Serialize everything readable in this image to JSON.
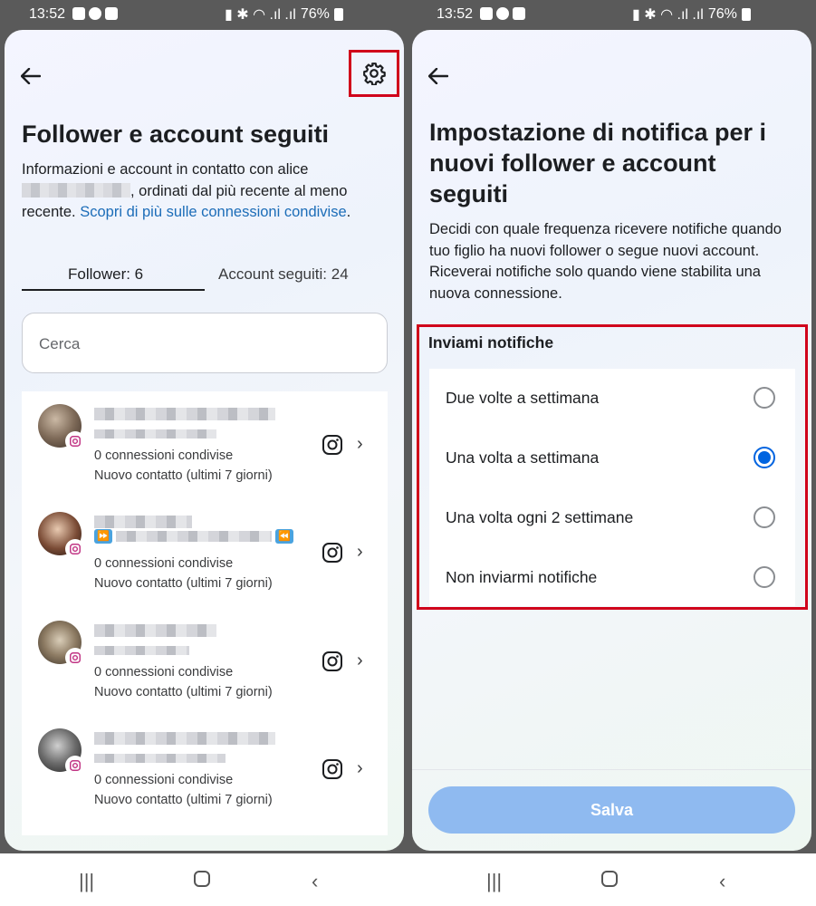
{
  "left": {
    "status": {
      "time": "13:52",
      "battery": "76%"
    },
    "title": "Follower e account seguiti",
    "desc_pre": "Informazioni e account in contatto con",
    "desc_name": "alice",
    "desc_post": ", ordinati dal più recente al meno recente.",
    "desc_link": "Scopri di più sulle connessioni condivise",
    "desc_end": ".",
    "tabs": {
      "followers": "Follower: 6",
      "following": "Account seguiti: 24"
    },
    "search_placeholder": "Cerca",
    "rows": [
      {
        "line1": "0 connessioni condivise",
        "line2": "Nuovo contatto (ultimi 7 giorni)"
      },
      {
        "line1": "0 connessioni condivise",
        "line2": "Nuovo contatto (ultimi 7 giorni)"
      },
      {
        "line1": "0 connessioni condivise",
        "line2": "Nuovo contatto (ultimi 7 giorni)"
      },
      {
        "line1": "0 connessioni condivise",
        "line2": "Nuovo contatto (ultimi 7 giorni)"
      }
    ]
  },
  "right": {
    "status": {
      "time": "13:52",
      "battery": "76%"
    },
    "title": "Impostazione di notifica per i nuovi follower e account seguiti",
    "desc": "Decidi con quale frequenza ricevere notifiche quando tuo figlio ha nuovi follower o segue nuovi account. Riceverai notifiche solo quando viene stabilita una nuova connessione.",
    "section": "Inviami notifiche",
    "options": [
      {
        "label": "Due volte a settimana",
        "selected": false
      },
      {
        "label": "Una volta a settimana",
        "selected": true
      },
      {
        "label": "Una volta ogni 2 settimane",
        "selected": false
      },
      {
        "label": "Non inviarmi notifiche",
        "selected": false
      }
    ],
    "save": "Salva"
  },
  "icons": {
    "back": "arrow-left-icon",
    "settings": "gear-icon",
    "instagram": "instagram-icon",
    "chevron": "chevron-right-icon"
  },
  "colors": {
    "highlight_box": "#d0021b",
    "link": "#1c6db8",
    "radio_selected": "#0064e0",
    "save_button": "#8fbaf0"
  }
}
